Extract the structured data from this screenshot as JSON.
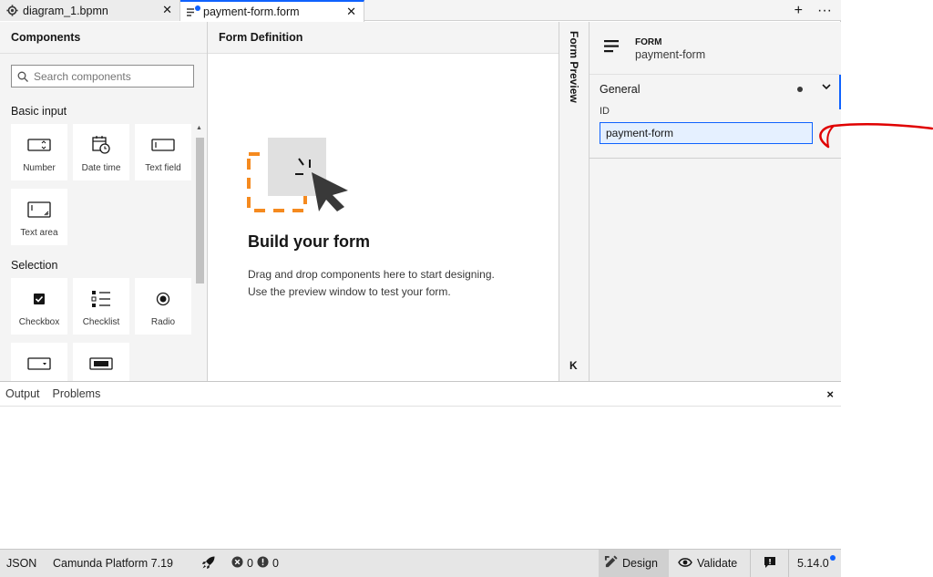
{
  "tabs": [
    {
      "label": "diagram_1.bpmn",
      "icon": "gear-icon"
    },
    {
      "label": "payment-form.form",
      "icon": "form-icon",
      "active": true
    }
  ],
  "tab_actions": {
    "add": "+",
    "more": "···"
  },
  "components": {
    "title": "Components",
    "search_placeholder": "Search components",
    "groups": [
      {
        "title": "Basic input",
        "items": [
          "Number",
          "Date time",
          "Text field",
          "Text area"
        ]
      },
      {
        "title": "Selection",
        "items": [
          "Checkbox",
          "Checklist",
          "Radio"
        ]
      }
    ]
  },
  "definition": {
    "title": "Form Definition",
    "empty_title": "Build your form",
    "empty_line1": "Drag and drop components here to start designing.",
    "empty_line2": "Use the preview window to test your form."
  },
  "preview": {
    "label": "Form Preview",
    "expand": "K"
  },
  "properties": {
    "type": "FORM",
    "name": "payment-form",
    "section": "General",
    "id_label": "ID",
    "id_value": "payment-form"
  },
  "output": {
    "tabs": [
      "Output",
      "Problems"
    ],
    "close": "×"
  },
  "status": {
    "format": "JSON",
    "platform": "Camunda Platform 7.19",
    "errors": "0",
    "warnings": "0",
    "design": "Design",
    "validate": "Validate",
    "version": "5.14.0"
  },
  "colors": {
    "accent": "#0f62fe",
    "annotation": "#e00000",
    "drop_target": "#f58a1f"
  }
}
